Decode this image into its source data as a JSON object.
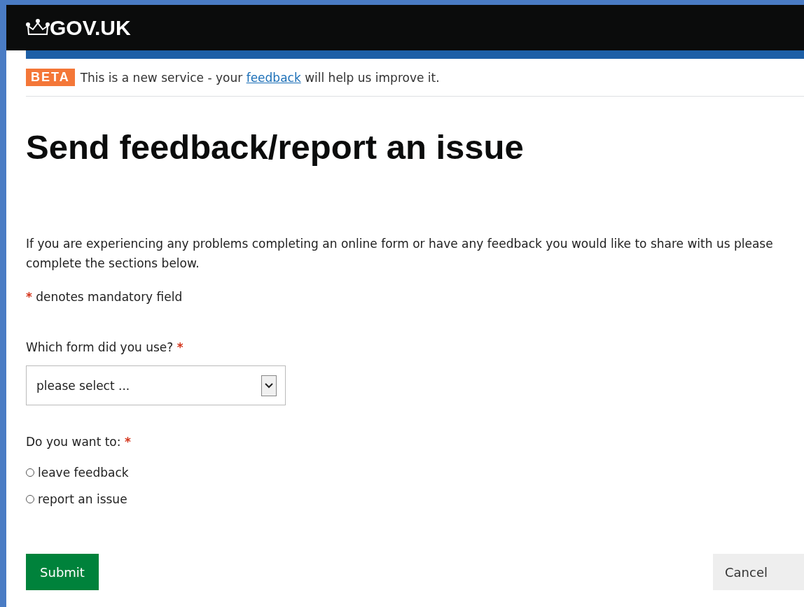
{
  "header": {
    "logo": "GOV.UK"
  },
  "phase_banner": {
    "tag": "BETA",
    "text_before": "This is a new service - your",
    "link": "feedback",
    "text_after": "will help us improve it."
  },
  "heading": "Send feedback/report an issue",
  "intro": "If you are experiencing any problems completing an online form or have any feedback you would like to share with us please complete the sections below.",
  "mandatory_note": {
    "marker": "*",
    "text": "denotes mandatory field"
  },
  "form_select": {
    "label": "Which form did you use?",
    "required": true,
    "value": "please select ..."
  },
  "choice": {
    "label": "Do you want to:",
    "required": true,
    "options": [
      {
        "label": "leave feedback",
        "selected": false
      },
      {
        "label": "report an issue",
        "selected": false
      }
    ]
  },
  "buttons": {
    "submit": "Submit",
    "cancel": "Cancel"
  }
}
